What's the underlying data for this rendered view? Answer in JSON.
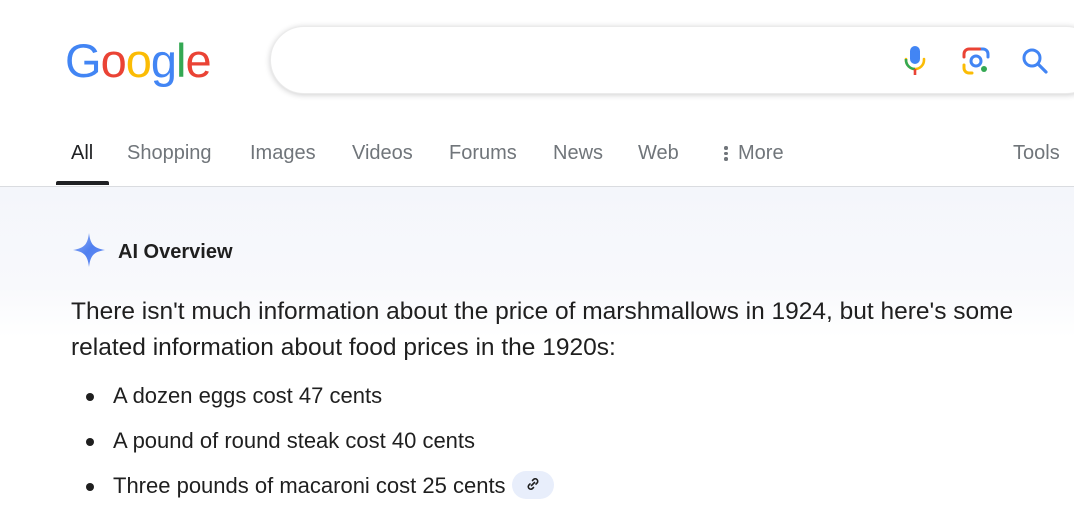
{
  "header": {
    "logo_letters": [
      {
        "char": "G",
        "color": "#4285F4"
      },
      {
        "char": "o",
        "color": "#EA4335"
      },
      {
        "char": "o",
        "color": "#FBBC05"
      },
      {
        "char": "g",
        "color": "#4285F4"
      },
      {
        "char": "l",
        "color": "#34A853"
      },
      {
        "char": "e",
        "color": "#EA4335"
      }
    ],
    "search": {
      "value": "",
      "icons": [
        "microphone-icon",
        "google-lens-icon",
        "search-icon"
      ]
    }
  },
  "tabs": {
    "items": [
      {
        "label": "All",
        "active": true
      },
      {
        "label": "Shopping"
      },
      {
        "label": "Images"
      },
      {
        "label": "Videos"
      },
      {
        "label": "Forums"
      },
      {
        "label": "News"
      },
      {
        "label": "Web"
      },
      {
        "label": "More",
        "icon": "vertical-dots-icon"
      }
    ],
    "tools_label": "Tools"
  },
  "ai_overview": {
    "title": "AI Overview",
    "icon": "sparkle-icon",
    "intro": "There isn't much information about the price of marshmallows in 1924, but here's some related information about food prices in the 1920s:",
    "bullets": [
      "A dozen eggs cost 47 cents",
      "A pound of round steak cost 40 cents",
      "Three pounds of macaroni cost 25 cents"
    ],
    "link_icon": "link-icon"
  },
  "colors": {
    "text_primary": "#1f1f1f",
    "tab_inactive": "#70757a",
    "search_blue": "#4285F4",
    "ai_background": "#f4f6fb",
    "link_chip_bg": "#e8eefb"
  }
}
